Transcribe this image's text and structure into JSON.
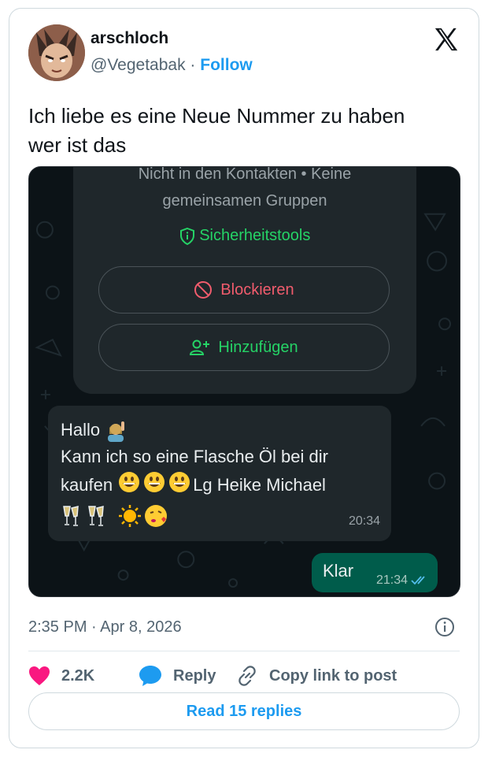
{
  "user": {
    "display_name": "arschloch",
    "handle": "@Vegetabak",
    "separator": " · ",
    "follow_label": "Follow"
  },
  "tweet": {
    "line1": "Ich liebe es eine Neue Nummer zu haben",
    "line2": "wer ist das"
  },
  "chat": {
    "contact_info_line1": "Nicht in den Kontakten  •  Keine",
    "contact_info_line2": "gemeinsamen Gruppen",
    "security_tools_label": "Sicherheitstools",
    "block_label": "Blockieren",
    "add_label": "Hinzufügen",
    "incoming": {
      "line1": "Hallo",
      "line2": "Kann ich so eine Flasche Öl bei dir",
      "line3_prefix": "kaufen",
      "line3_suffix": "Lg Heike  Michael",
      "time": "20:34"
    },
    "outgoing": {
      "text": "Klar",
      "time": "21:34"
    }
  },
  "meta": {
    "time": "2:35 PM",
    "separator": " · ",
    "date": "Apr 8, 2026"
  },
  "actions": {
    "like_count": "2.2K",
    "reply_label": "Reply",
    "copy_label": "Copy link to post"
  },
  "read_replies_label": "Read 15 replies",
  "colors": {
    "accent": "#1d9bf0",
    "like": "#f91880",
    "whatsapp_green": "#25d366",
    "block_red": "#f15c6d",
    "outgoing_bubble": "#005c4b"
  }
}
